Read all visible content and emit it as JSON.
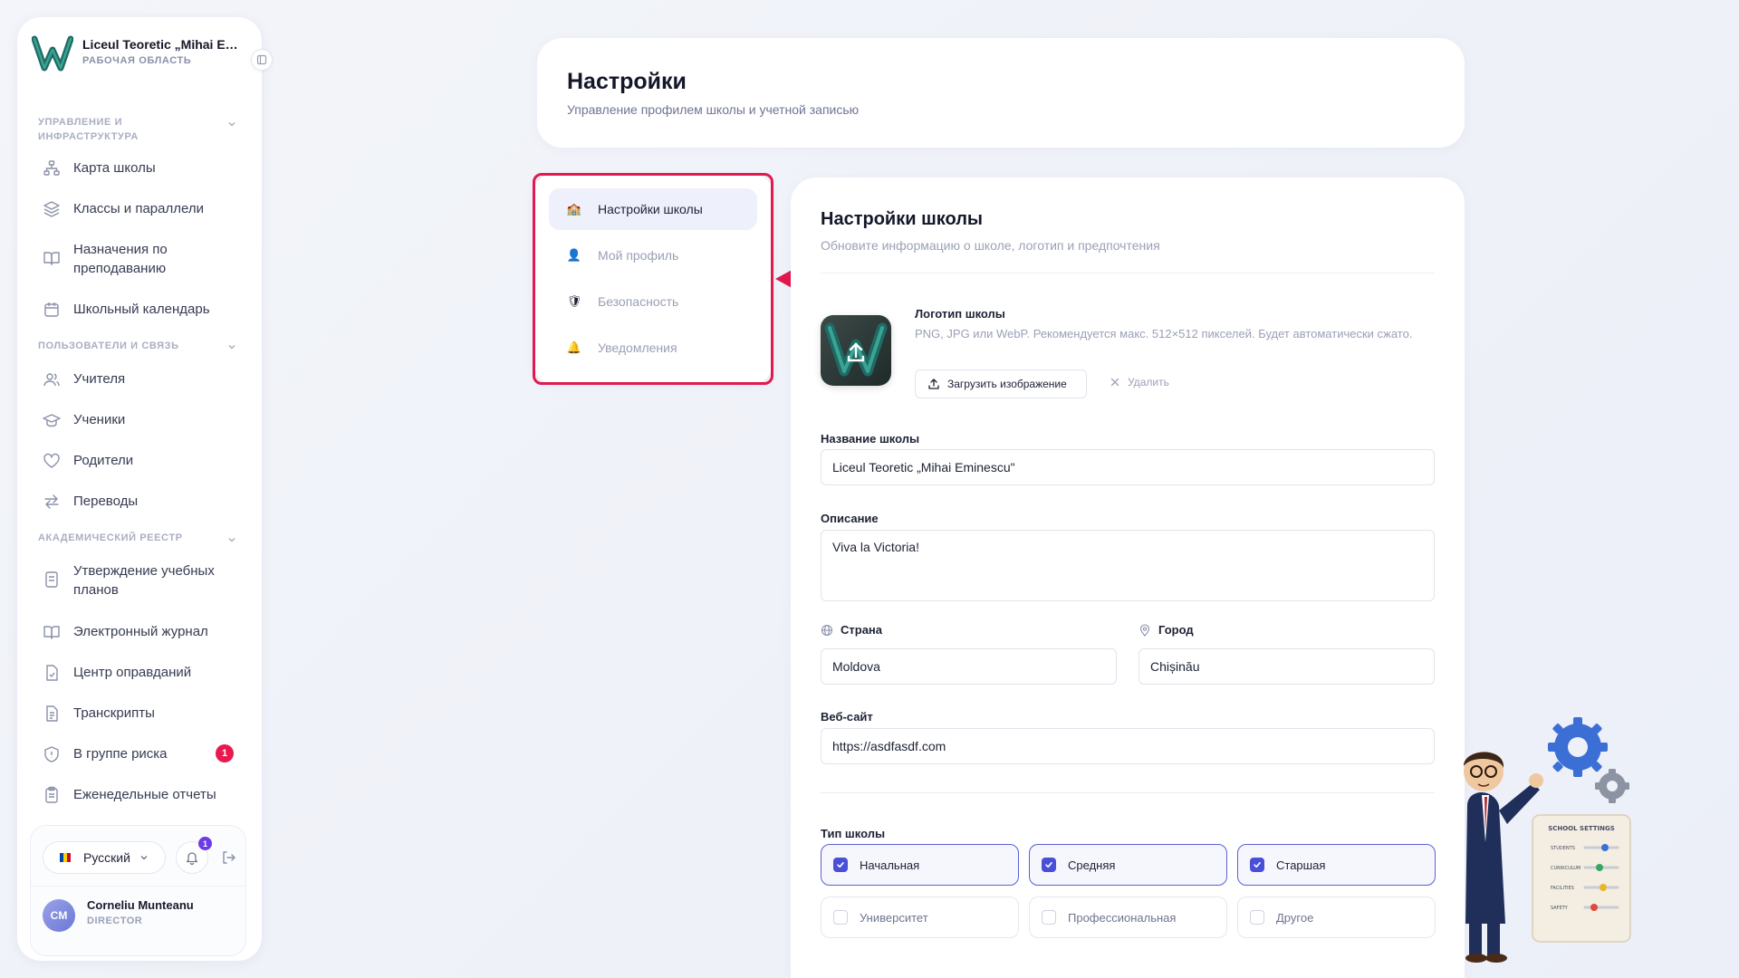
{
  "workspace": {
    "name": "Liceul Teoretic „Mihai Emi...",
    "subtitle": "РАБОЧАЯ ОБЛАСТЬ"
  },
  "sidebar": {
    "sections": [
      {
        "title": "УПРАВЛЕНИЕ И ИНФРАСТРУКТУРА",
        "items": [
          {
            "label": "Карта школы",
            "icon": "sitemap-icon"
          },
          {
            "label": "Классы и параллели",
            "icon": "layers-icon"
          },
          {
            "label": "Назначения по преподаванию",
            "icon": "open-book-icon"
          },
          {
            "label": "Школьный календарь",
            "icon": "calendar-icon"
          }
        ]
      },
      {
        "title": "ПОЛЬЗОВАТЕЛИ И СВЯЗЬ",
        "items": [
          {
            "label": "Учителя",
            "icon": "users-icon"
          },
          {
            "label": "Ученики",
            "icon": "graduation-cap-icon"
          },
          {
            "label": "Родители",
            "icon": "heart-icon"
          },
          {
            "label": "Переводы",
            "icon": "transfer-arrows-icon"
          }
        ]
      },
      {
        "title": "АКАДЕМИЧЕСКИЙ РЕЕСТР",
        "items": [
          {
            "label": "Утверждение учебных планов",
            "icon": "document-check-icon"
          },
          {
            "label": "Электронный журнал",
            "icon": "journal-icon"
          },
          {
            "label": "Центр оправданий",
            "icon": "file-check-icon"
          },
          {
            "label": "Транскрипты",
            "icon": "file-text-icon"
          },
          {
            "label": "В группе риска",
            "icon": "shield-alert-icon",
            "badge": "1"
          },
          {
            "label": "Еженедельные отчеты",
            "icon": "clipboard-icon"
          }
        ]
      }
    ],
    "language": "Русский",
    "notifications_count": "1",
    "user": {
      "initials": "CM",
      "name": "Corneliu Munteanu",
      "role": "DIRECTOR"
    }
  },
  "header": {
    "title": "Настройки",
    "subtitle": "Управление профилем школы и учетной записью"
  },
  "tabs": [
    {
      "label": "Настройки школы",
      "icon": "school-icon",
      "active": true
    },
    {
      "label": "Мой профиль",
      "icon": "person-icon",
      "active": false
    },
    {
      "label": "Безопасность",
      "icon": "shield-icon",
      "active": false
    },
    {
      "label": "Уведомления",
      "icon": "bell-icon",
      "active": false
    }
  ],
  "school_settings": {
    "title": "Настройки школы",
    "subtitle": "Обновите информацию о школе, логотип и предпочтения",
    "logo": {
      "label": "Логотип школы",
      "hint": "PNG, JPG или WebP. Рекомендуется макс. 512×512 пикселей. Будет автоматически сжато.",
      "upload_label": "Загрузить изображение",
      "delete_label": "Удалить"
    },
    "fields": {
      "name_label": "Название школы",
      "name_value": "Liceul Teoretic „Mihai Eminescu\"",
      "description_label": "Описание",
      "description_value": "Viva la Victoria!",
      "country_label": "Страна",
      "country_value": "Moldova",
      "city_label": "Город",
      "city_value": "Chișinău",
      "website_label": "Веб-сайт",
      "website_value": "https://asdfasdf.com"
    },
    "school_type": {
      "label": "Тип школы",
      "options": [
        {
          "label": "Начальная",
          "checked": true
        },
        {
          "label": "Средняя",
          "checked": true
        },
        {
          "label": "Старшая",
          "checked": true
        },
        {
          "label": "Университет",
          "checked": false
        },
        {
          "label": "Профессиональная",
          "checked": false
        },
        {
          "label": "Другое",
          "checked": false
        }
      ]
    }
  },
  "illustration": {
    "board_title": "SCHOOL SETTINGS",
    "board_rows": [
      "STUDENTS",
      "CURRICULUM",
      "FACILITIES",
      "SAFETY"
    ]
  },
  "colors": {
    "accent": "#4b4fd8",
    "highlight": "#e01a4f",
    "badge_red": "#e8194f",
    "badge_purple": "#6d3be8"
  }
}
